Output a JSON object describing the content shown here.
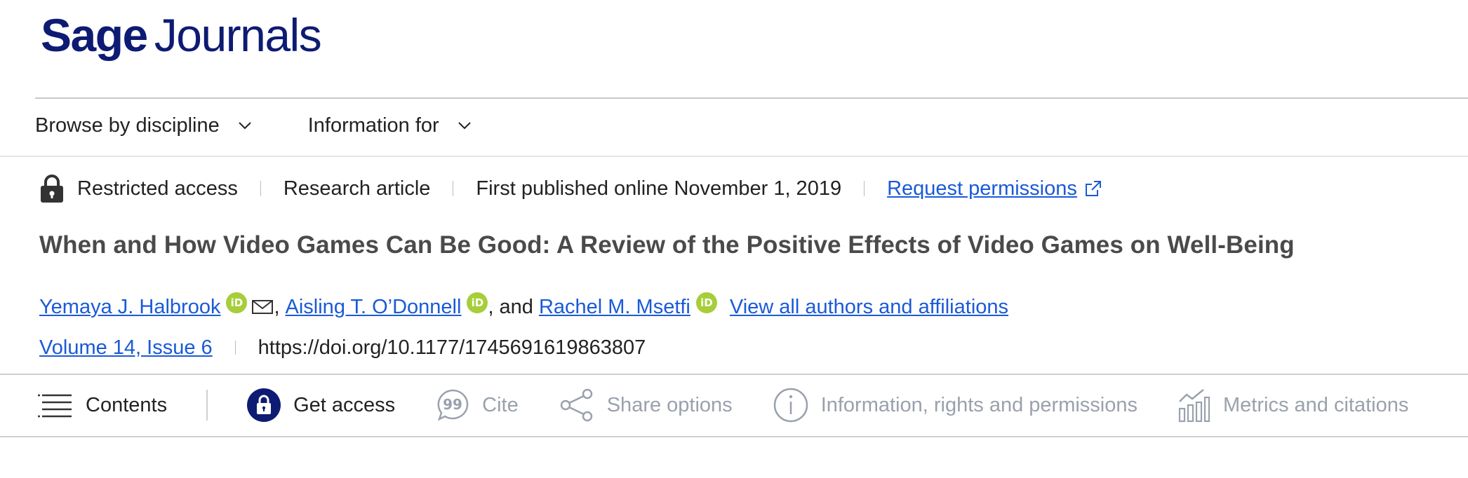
{
  "logo": {
    "part1": "Sage",
    "part2": "Journals"
  },
  "nav": {
    "browse_label": "Browse by discipline",
    "info_label": "Information for"
  },
  "meta": {
    "access": "Restricted access",
    "type": "Research article",
    "published": "First published online November 1, 2019",
    "permissions": "Request permissions"
  },
  "article": {
    "title": "When and How Video Games Can Be Good: A Review of the Positive Effects of Video Games on Well-Being"
  },
  "authors": {
    "a1": "Yemaya J. Halbrook",
    "a2": "Aisling T. O’Donnell",
    "a3": "Rachel M. Msetfi",
    "sep_comma": ",",
    "sep_and": ", and",
    "view_all": "View all authors and affiliations",
    "orcid_text": "iD"
  },
  "volume": {
    "label": "Volume 14, Issue 6",
    "doi": "https://doi.org/10.1177/1745691619863807"
  },
  "toolbar": {
    "contents": "Contents",
    "get_access": "Get access",
    "cite": "Cite",
    "share": "Share options",
    "info": "Information, rights and permissions",
    "metrics": "Metrics and citations"
  },
  "colors": {
    "brand": "#0d1b73",
    "link": "#1a5ad7",
    "orcid": "#a6ce39",
    "dim": "#9aa1ad"
  }
}
